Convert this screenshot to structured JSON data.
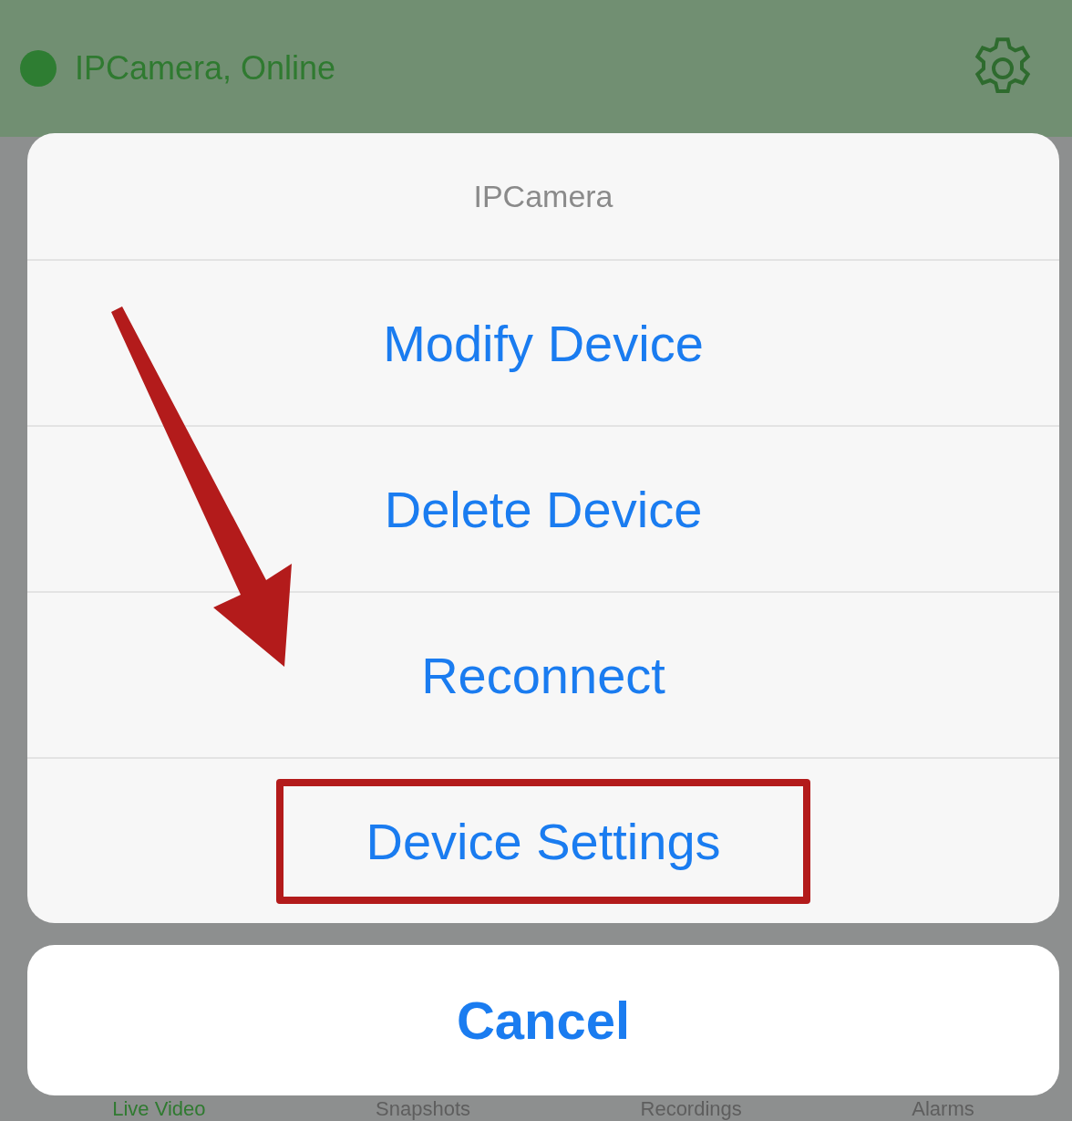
{
  "header": {
    "title": "IPCamera, Online",
    "online": true
  },
  "action_sheet": {
    "title": "IPCamera",
    "actions": [
      {
        "label": "Modify Device",
        "highlighted": false
      },
      {
        "label": "Delete Device",
        "highlighted": false
      },
      {
        "label": "Reconnect",
        "highlighted": false
      },
      {
        "label": "Device Settings",
        "highlighted": true
      }
    ],
    "cancel": "Cancel"
  },
  "tabs": [
    {
      "label": "Live Video",
      "selected": true
    },
    {
      "label": "Snapshots",
      "selected": false
    },
    {
      "label": "Recordings",
      "selected": false
    },
    {
      "label": "Alarms",
      "selected": false
    }
  ]
}
